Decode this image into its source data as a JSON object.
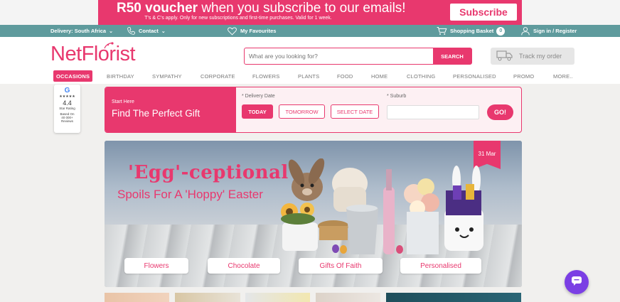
{
  "promo": {
    "headline_bold": "R50 voucher",
    "headline_rest": " when you subscribe to our emails!",
    "fine_print_1": "T's & C's apply. Only for new subscriptions and first-time purchases. Valid for 1 week.",
    "subscribe_label": "Subscribe",
    "colors": {
      "brand": "#e8386e",
      "utility_bar": "#5f9b9d"
    }
  },
  "utility": {
    "delivery": "Delivery: South Africa",
    "contact": "Contact",
    "favourites": "My Favourites",
    "basket": "Shopping Basket",
    "basket_count": "0",
    "signin": "Sign in / Register"
  },
  "header": {
    "logo": "NetFlorist",
    "search_placeholder": "What are you looking for?",
    "search_button": "SEARCH",
    "track_order": "Track my order"
  },
  "nav": {
    "items": [
      "OCCASIONS",
      "BIRTHDAY",
      "SYMPATHY",
      "CORPORATE",
      "FLOWERS",
      "PLANTS",
      "FOOD",
      "HOME",
      "CLOTHING",
      "PERSONALISED",
      "PROMO",
      "MORE.."
    ],
    "active": "OCCASIONS"
  },
  "rating": {
    "brand": "G",
    "stars": "★★★★★",
    "score": "4.4",
    "label": "Star Rating",
    "based_1": "Based On",
    "based_2": "40 000+",
    "based_3": "Reviews"
  },
  "finder": {
    "start_here": "Start Here",
    "title": "Find The Perfect Gift",
    "delivery_date_label": "* Delivery Date",
    "today": "TODAY",
    "tomorrow": "TOMORROW",
    "select_date": "SELECT DATE",
    "suburb_label": "* Suburb",
    "suburb_value": "",
    "go": "GO!"
  },
  "hero": {
    "title_line1": "'Egg'-ceptional",
    "title_line2": "Spoils For A 'Hoppy' Easter",
    "date_badge": "31 Mar",
    "pills": [
      "Flowers",
      "Chocolate",
      "Gifts Of Faith",
      "Personalised"
    ]
  },
  "chat": {
    "icon": "chat-bubble-icon"
  }
}
